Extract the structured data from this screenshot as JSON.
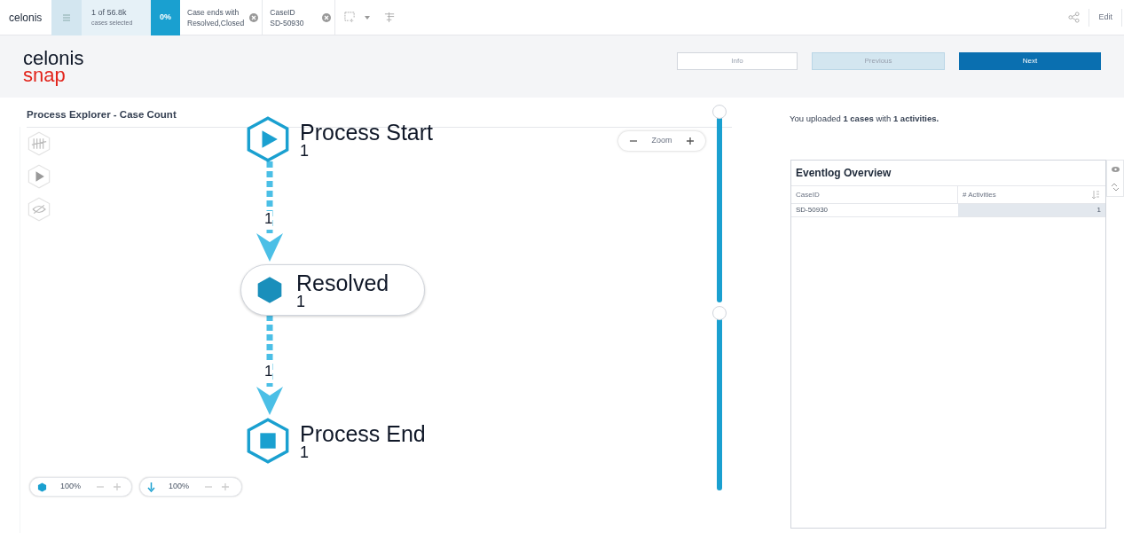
{
  "topbar": {
    "logo": "celonis",
    "cases": "1 of 56.8k",
    "cases_caption": "cases selected",
    "percentage": "0%",
    "filters": [
      {
        "lines": [
          "Case ends with",
          "Resolved,Closed"
        ]
      },
      {
        "lines": [
          "CaseID",
          "SD-50930"
        ]
      }
    ],
    "edit": "Edit"
  },
  "header": {
    "logo": [
      "celonis",
      "snap"
    ],
    "buttons": [
      {
        "label": "Info",
        "kind": "plain"
      },
      {
        "label": "Previous",
        "kind": "secondary"
      },
      {
        "label": "Next",
        "kind": "primary"
      }
    ]
  },
  "explorer": {
    "title": "Process Explorer - Case Count",
    "zoom_label": "Zoom",
    "nodes": [
      {
        "kind": "start",
        "label": "Process Start",
        "count": "1"
      },
      {
        "kind": "activity",
        "label": "Resolved",
        "count": "1"
      },
      {
        "kind": "end",
        "label": "Process End",
        "count": "1"
      }
    ],
    "edges": [
      {
        "count": "1"
      },
      {
        "count": "1"
      }
    ],
    "sliders": [
      {
        "level": 1
      },
      {
        "level": 1
      }
    ],
    "bottom_controls": [
      {
        "kind": "activities",
        "value": "100%"
      },
      {
        "kind": "connections",
        "value": "100%"
      }
    ]
  },
  "summary": "You uploaded **1 cases** with **1 activities.**",
  "eventlog": {
    "title": "Eventlog Overview",
    "columns": [
      "CaseID",
      "# Activities"
    ],
    "rows": [
      [
        "SD-50930",
        "1"
      ]
    ]
  }
}
